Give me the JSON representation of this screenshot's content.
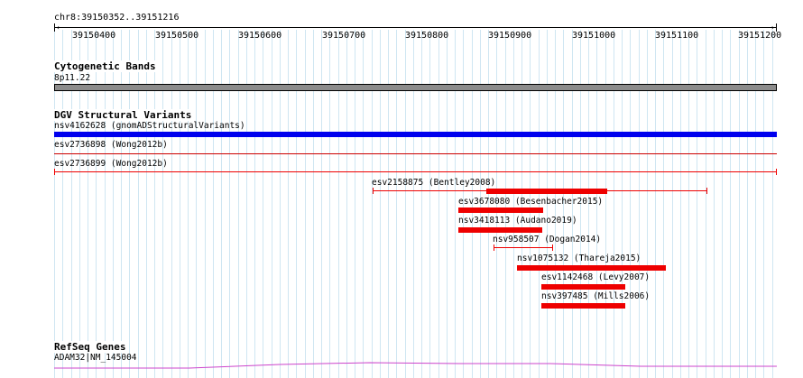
{
  "browser": {
    "position": "chr8:39150352..39151216",
    "ticks": [
      "39150400",
      "39150500",
      "39150600",
      "39150700",
      "39150800",
      "39150900",
      "39151000",
      "39151100",
      "39151200"
    ],
    "colors": {
      "grid": "#cfe6f2",
      "sv_loss": "#ee0000",
      "sv_blue": "#0000ee",
      "gene": "#cc44cc",
      "band": "#8c8c8c"
    }
  },
  "cytoband": {
    "title": "Cytogenetic Bands",
    "band": "8p11.22"
  },
  "dgv": {
    "title": "DGV Structural Variants",
    "items": [
      {
        "label": "nsv4162628 (gnomADStructuralVariants)"
      },
      {
        "label": "esv2736898 (Wong2012b)"
      },
      {
        "label": "esv2736899 (Wong2012b)"
      },
      {
        "label": "esv2158875 (Bentley2008)"
      },
      {
        "label": "esv3678080 (Besenbacher2015)"
      },
      {
        "label": "nsv3418113 (Audano2019)"
      },
      {
        "label": "nsv958507 (Dogan2014)"
      },
      {
        "label": "nsv1075132 (Thareja2015)"
      },
      {
        "label": "esv1142468 (Levy2007)"
      },
      {
        "label": "nsv397485 (Mills2006)"
      }
    ]
  },
  "refseq": {
    "title": "RefSeq Genes",
    "gene": "ADAM32|NM_145004"
  }
}
